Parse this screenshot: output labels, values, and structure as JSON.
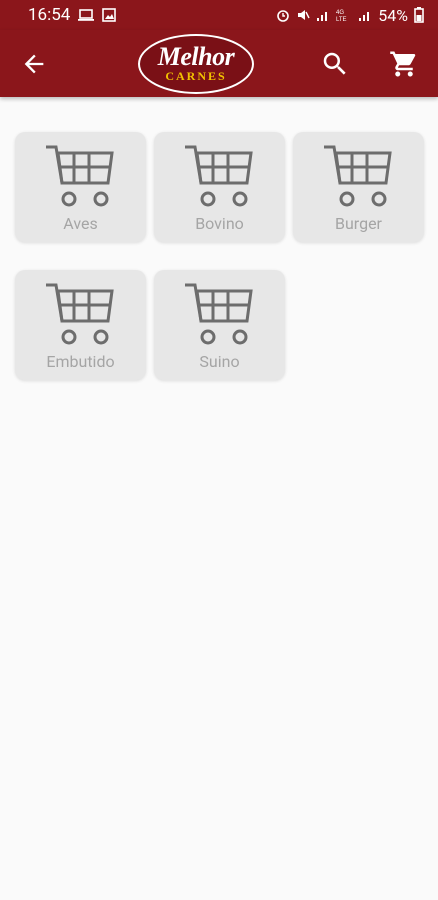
{
  "status_bar": {
    "time": "16:54",
    "battery": "54%",
    "left_icons": [
      "laptop-icon",
      "image-icon"
    ],
    "right_icons": [
      "alarm-icon",
      "mute-icon",
      "signal-icon",
      "lte-icon",
      "signal-icon",
      "battery-icon"
    ]
  },
  "app_bar": {
    "logo_top": "Melhor",
    "logo_bottom": "CARNES",
    "actions": [
      "back-arrow-icon",
      "search-icon",
      "cart-icon"
    ],
    "background": "#8b161b"
  },
  "categories": [
    {
      "label": "Aves"
    },
    {
      "label": "Bovino"
    },
    {
      "label": "Burger"
    },
    {
      "label": "Embutido"
    },
    {
      "label": "Suino"
    }
  ]
}
